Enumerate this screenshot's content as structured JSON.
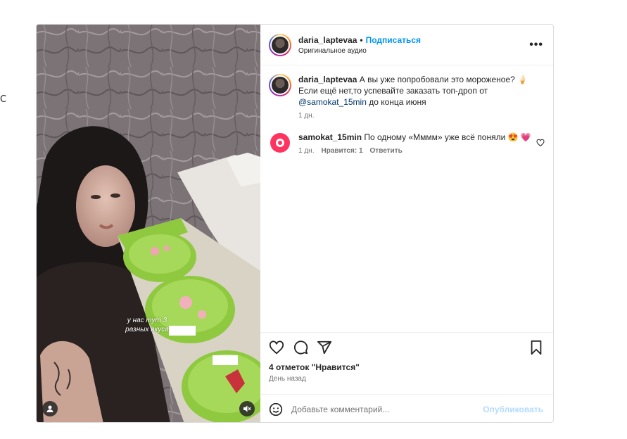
{
  "page": {
    "edge_letter": "С"
  },
  "post": {
    "video_caption": "у нас тут 3 разных вкуса",
    "header": {
      "username": "daria_laptevaa",
      "separator": "•",
      "follow_label": "Подписаться",
      "audio": "Оригинальное аудио",
      "more_label": "•••"
    },
    "caption": {
      "username": "daria_laptevaa",
      "text_before": "А вы уже попробовали это мороженое? 🍦 Если ещё нет,то успевайте заказать топ-дроп от ",
      "mention": "@samokat_15min",
      "text_after": " до конца июня",
      "time": "1 дн."
    },
    "comments": [
      {
        "username": "samokat_15min",
        "text": "По одному «Мммм» уже всё поняли 😍 💗",
        "time": "1 дн.",
        "likes": "Нравится: 1",
        "reply": "Ответить"
      }
    ],
    "likes_text": "4 отметок \"Нравится\"",
    "date_text": "День назад",
    "comment_placeholder": "Добавьте комментарий...",
    "publish_label": "Опубликовать",
    "colors": {
      "accent": "#0095f6",
      "samokat": "#ff335f",
      "publish_disabled": "#b3dbff"
    },
    "icons": [
      "heart-icon",
      "comment-icon",
      "share-icon",
      "bookmark-icon",
      "emoji-icon",
      "more-icon",
      "user-tag-icon",
      "mute-icon"
    ]
  }
}
